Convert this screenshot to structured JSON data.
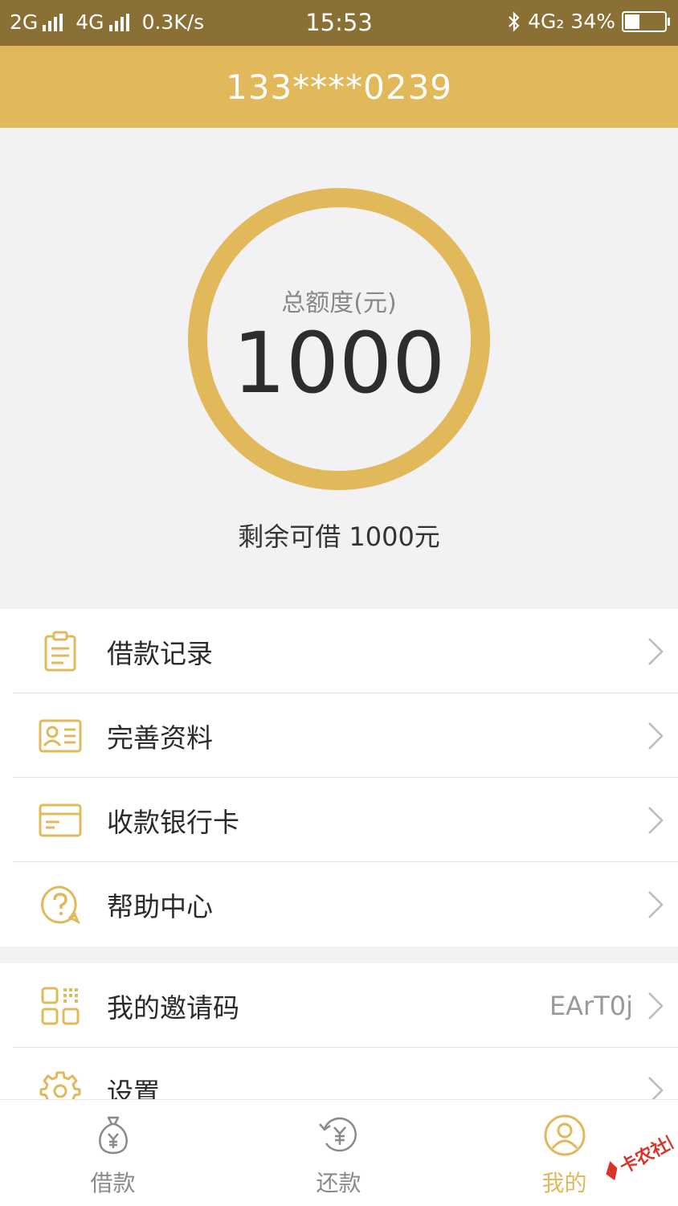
{
  "status_bar": {
    "network_left": "2G",
    "network_right": "4G",
    "speed": "0.3K/s",
    "time": "15:53",
    "network_indicator": "4G₂",
    "battery": "34%",
    "battery_level": 0.34
  },
  "header": {
    "title": "133****0239"
  },
  "credit": {
    "label": "总额度(元)",
    "amount": "1000",
    "remaining": "剩余可借 1000元"
  },
  "menu_group1": [
    {
      "label": "借款记录",
      "icon": "clipboard-icon"
    },
    {
      "label": "完善资料",
      "icon": "id-card-icon"
    },
    {
      "label": "收款银行卡",
      "icon": "bank-card-icon"
    },
    {
      "label": "帮助中心",
      "icon": "help-icon"
    }
  ],
  "menu_group2": [
    {
      "label": "我的邀请码",
      "value": "EArT0j",
      "icon": "qr-code-icon"
    },
    {
      "label": "设置",
      "icon": "gear-icon"
    }
  ],
  "tabs": [
    {
      "label": "借款",
      "icon": "money-bag-icon"
    },
    {
      "label": "还款",
      "icon": "repay-icon"
    },
    {
      "label": "我的",
      "icon": "user-icon",
      "active": true
    }
  ],
  "watermark": {
    "text": "卡农社区"
  },
  "colors": {
    "accent": "#e1b85a",
    "status_bar": "#8a7034",
    "background": "#f2f2f4"
  }
}
